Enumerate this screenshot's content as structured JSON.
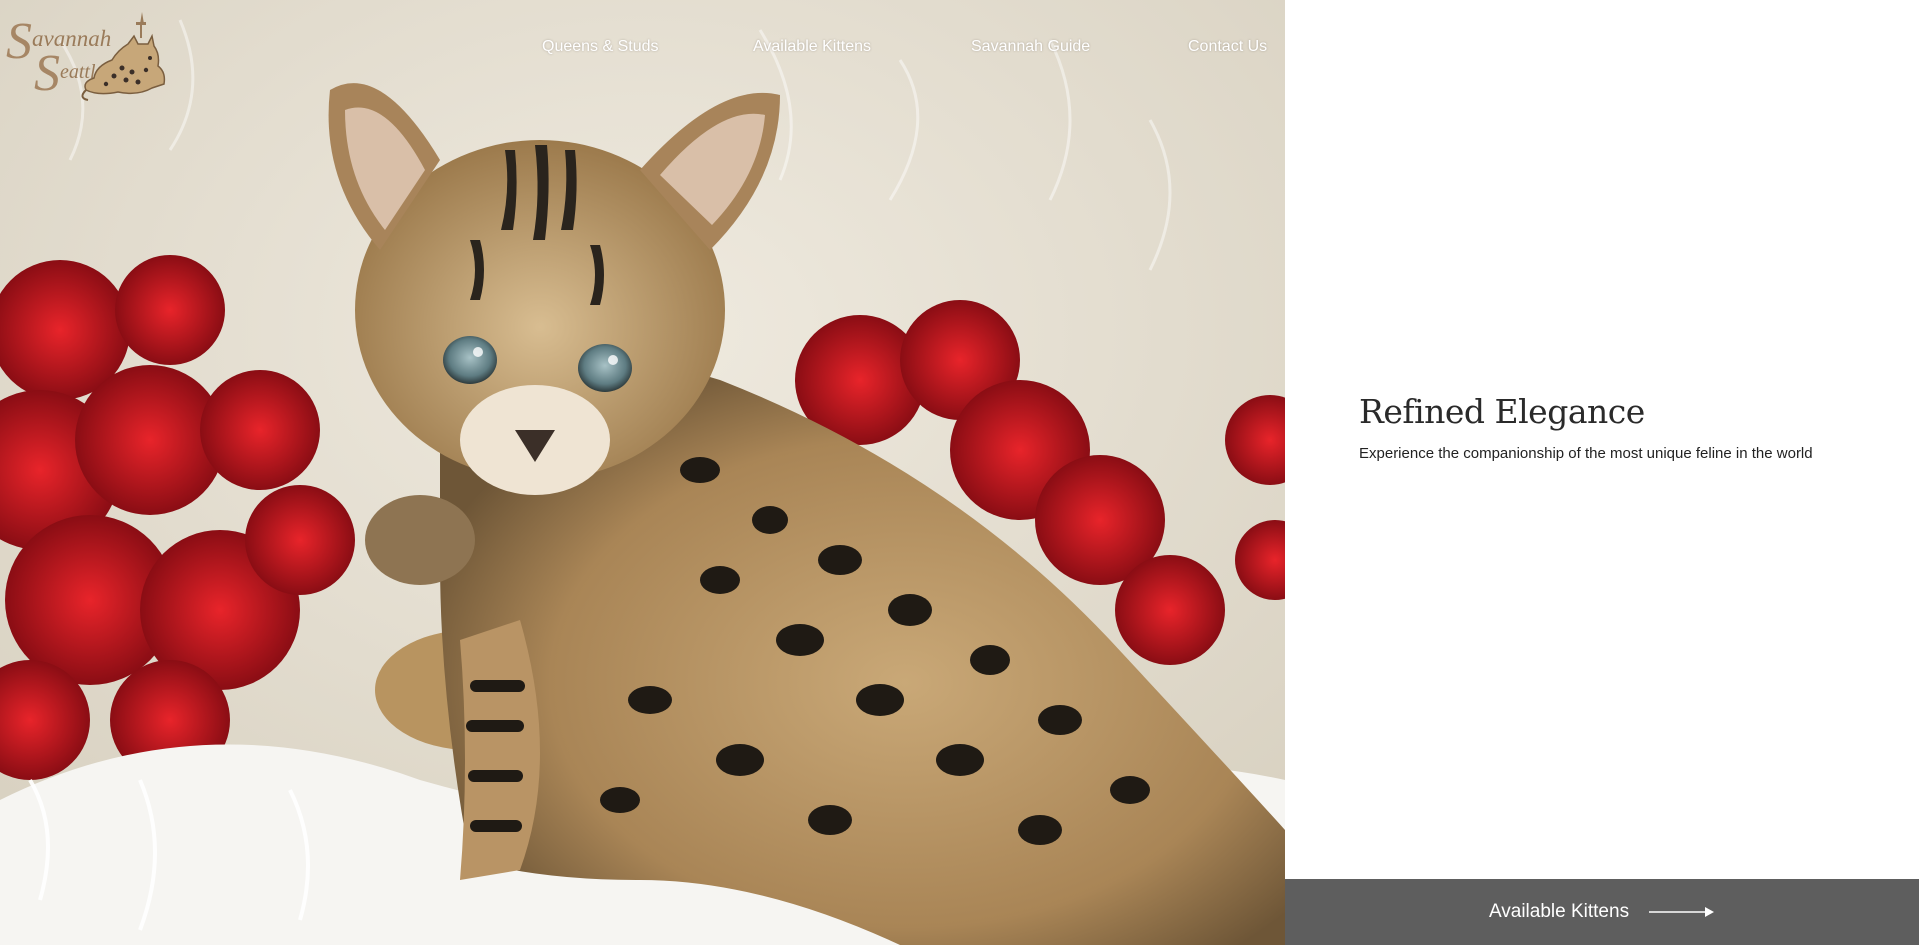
{
  "brand": {
    "logo_line_1": "avannah",
    "logo_line_1_initial": "S",
    "logo_line_2": "eattle",
    "logo_line_2_initial": "S",
    "logo_color": "#9a7b5a"
  },
  "nav": {
    "items": [
      {
        "label": "Queens & Studs"
      },
      {
        "label": "Available Kittens"
      },
      {
        "label": "Savannah Guide"
      },
      {
        "label": "Contact Us"
      }
    ]
  },
  "hero": {
    "headline": "Refined Elegance",
    "subline": "Experience the companionship of the most unique feline in the world"
  },
  "cta": {
    "label": "Available Kittens",
    "icon": "arrow-right-icon",
    "background": "#5e5e5e"
  }
}
